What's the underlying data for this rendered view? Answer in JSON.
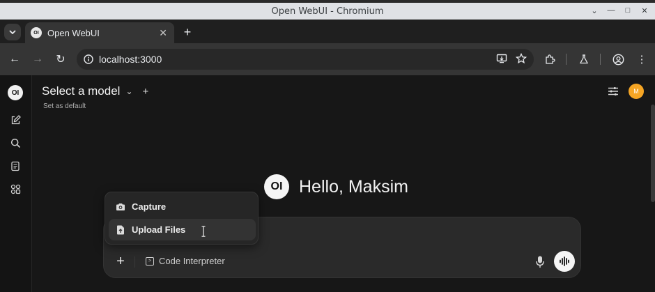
{
  "window": {
    "title": "Open WebUI - Chromium"
  },
  "tab": {
    "title": "Open WebUI",
    "favicon_text": "OI"
  },
  "toolbar": {
    "url": "localhost:3000"
  },
  "app": {
    "logo_text": "OI",
    "model_selector": "Select a model",
    "set_default": "Set as default",
    "avatar_initial": "M",
    "greeting": "Hello, Maksim",
    "input": {
      "code_interpreter_label": "Code Interpreter"
    },
    "attach_menu": [
      {
        "label": "Capture",
        "icon": "camera-icon"
      },
      {
        "label": "Upload Files",
        "icon": "file-upload-icon"
      }
    ]
  },
  "colors": {
    "background": "#171717",
    "input_bg": "#2a2a2a",
    "avatar": "#f5a524",
    "titlebar": "#dfe1e5"
  }
}
